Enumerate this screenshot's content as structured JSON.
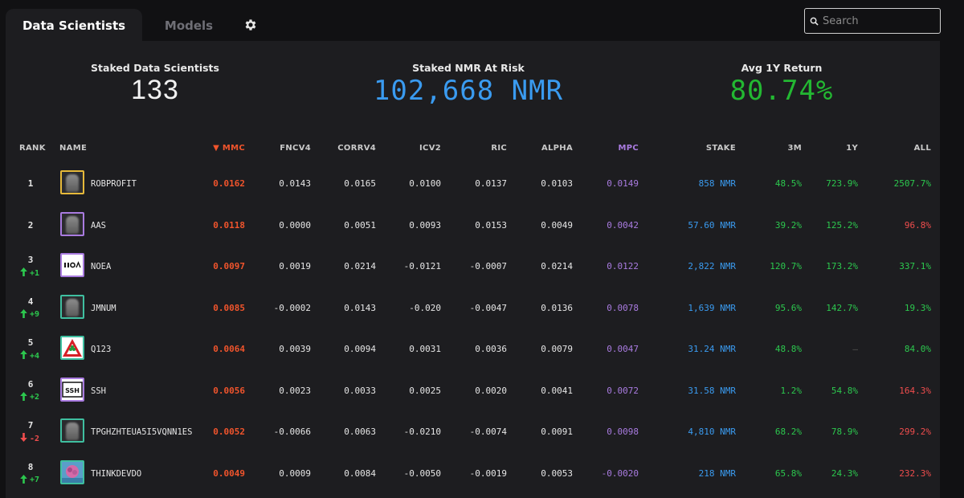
{
  "tabs": {
    "data_scientists": "Data Scientists",
    "models": "Models"
  },
  "search": {
    "placeholder": "Search"
  },
  "stats": [
    {
      "label": "Staked Data Scientists",
      "value": "133",
      "color": "#f2f2f2"
    },
    {
      "label": "Staked NMR At Risk",
      "value": "102,668 NMR",
      "color": "#3a9bf0"
    },
    {
      "label": "Avg 1Y Return",
      "value": "80.74%",
      "color": "#23b832"
    }
  ],
  "columns": {
    "rank": "RANK",
    "name": "NAME",
    "mmc": "▼ MMC",
    "fncv4": "FNCV4",
    "corrv4": "CORRV4",
    "icv2": "ICV2",
    "ric": "RIC",
    "alpha": "ALPHA",
    "mpc": "MPC",
    "stake": "STAKE",
    "m3": "3M",
    "y1": "1Y",
    "all": "ALL"
  },
  "colors": {
    "mmc": "#f0542c",
    "mpc": "#a97be0",
    "stake": "#3a9bf0",
    "positive": "#2cc84e",
    "negative": "#f04d4d"
  },
  "rows": [
    {
      "rank": "1",
      "change": "",
      "dir": "",
      "name": "ROBPROFIT",
      "avatar": "ghost",
      "border": "#e6b93a",
      "mmc": "0.0162",
      "fncv4": "0.0143",
      "corrv4": "0.0165",
      "icv2": "0.0100",
      "ric": "0.0137",
      "alpha": "0.0103",
      "mpc": "0.0149",
      "stake": "858 NMR",
      "m3": "48.5%",
      "m3c": "g",
      "y1": "723.9%",
      "y1c": "g",
      "all": "2507.7%",
      "allc": "g"
    },
    {
      "rank": "2",
      "change": "",
      "dir": "",
      "name": "AAS",
      "avatar": "ghost",
      "border": "#a97be0",
      "mmc": "0.0118",
      "fncv4": "0.0000",
      "corrv4": "0.0051",
      "icv2": "0.0093",
      "ric": "0.0153",
      "alpha": "0.0049",
      "mpc": "0.0042",
      "stake": "57.60 NMR",
      "m3": "39.2%",
      "m3c": "g",
      "y1": "125.2%",
      "y1c": "g",
      "all": "96.8%",
      "allc": "r"
    },
    {
      "rank": "3",
      "change": "+1",
      "dir": "up",
      "name": "NOEA",
      "avatar": "noea",
      "border": "#a97be0",
      "mmc": "0.0097",
      "fncv4": "0.0019",
      "corrv4": "0.0214",
      "icv2": "-0.0121",
      "ric": "-0.0007",
      "alpha": "0.0214",
      "mpc": "0.0122",
      "stake": "2,822 NMR",
      "m3": "120.7%",
      "m3c": "g",
      "y1": "173.2%",
      "y1c": "g",
      "all": "337.1%",
      "allc": "g"
    },
    {
      "rank": "4",
      "change": "+9",
      "dir": "up",
      "name": "JMNUM",
      "avatar": "ghost",
      "border": "#3fbfa0",
      "mmc": "0.0085",
      "fncv4": "-0.0002",
      "corrv4": "0.0143",
      "icv2": "-0.020",
      "ric": "-0.0047",
      "alpha": "0.0136",
      "mpc": "0.0078",
      "stake": "1,639 NMR",
      "m3": "95.6%",
      "m3c": "g",
      "y1": "142.7%",
      "y1c": "g",
      "all": "19.3%",
      "allc": "g"
    },
    {
      "rank": "5",
      "change": "+4",
      "dir": "up",
      "name": "Q123",
      "avatar": "q123",
      "border": "#3fbfa0",
      "mmc": "0.0064",
      "fncv4": "0.0039",
      "corrv4": "0.0094",
      "icv2": "0.0031",
      "ric": "0.0036",
      "alpha": "0.0079",
      "mpc": "0.0047",
      "stake": "31.24 NMR",
      "m3": "48.8%",
      "m3c": "g",
      "y1": "–",
      "y1c": "d",
      "all": "84.0%",
      "allc": "g"
    },
    {
      "rank": "6",
      "change": "+2",
      "dir": "up",
      "name": "SSH",
      "avatar": "ssh",
      "border": "#a97be0",
      "mmc": "0.0056",
      "fncv4": "0.0023",
      "corrv4": "0.0033",
      "icv2": "0.0025",
      "ric": "0.0020",
      "alpha": "0.0041",
      "mpc": "0.0072",
      "stake": "31.58 NMR",
      "m3": "1.2%",
      "m3c": "g",
      "y1": "54.8%",
      "y1c": "g",
      "all": "164.3%",
      "allc": "r"
    },
    {
      "rank": "7",
      "change": "-2",
      "dir": "down",
      "name": "TPGHZHTEUA5I5VQNN1ES",
      "avatar": "ghost",
      "border": "#3fbfa0",
      "mmc": "0.0052",
      "fncv4": "-0.0066",
      "corrv4": "0.0063",
      "icv2": "-0.0210",
      "ric": "-0.0074",
      "alpha": "0.0091",
      "mpc": "0.0098",
      "stake": "4,810 NMR",
      "m3": "68.2%",
      "m3c": "g",
      "y1": "78.9%",
      "y1c": "g",
      "all": "299.2%",
      "allc": "r"
    },
    {
      "rank": "8",
      "change": "+7",
      "dir": "up",
      "name": "THINKDEVDO",
      "avatar": "think",
      "border": "#3fbfa0",
      "mmc": "0.0049",
      "fncv4": "0.0009",
      "corrv4": "0.0084",
      "icv2": "-0.0050",
      "ric": "-0.0019",
      "alpha": "0.0053",
      "mpc": "-0.0020",
      "stake": "218 NMR",
      "m3": "65.8%",
      "m3c": "g",
      "y1": "24.3%",
      "y1c": "g",
      "all": "232.3%",
      "allc": "r"
    }
  ]
}
